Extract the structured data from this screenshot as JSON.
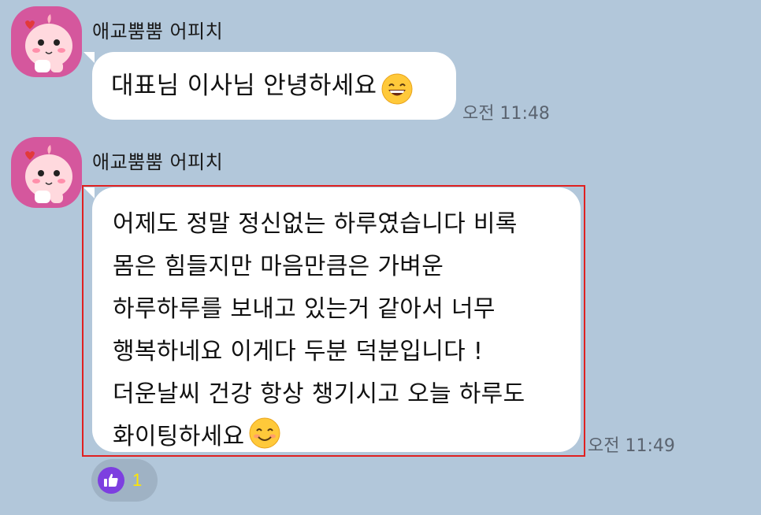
{
  "messages": [
    {
      "sender": "애교뿜뿜 어피치",
      "avatar_icon": "apeach-avatar-icon",
      "text": "대표님 이사님 안녕하세요",
      "emoji_icon": "grinning-face-emoji-icon",
      "time": "오전 11:48"
    },
    {
      "sender": "애교뿜뿜 어피치",
      "avatar_icon": "apeach-avatar-icon",
      "text": "어제도 정말 정신없는 하루였습니다 비록\n몸은 힘들지만 마음만큼은 가벼운\n하루하루를 보내고 있는거 같아서 너무\n행복하네요 이게다 두분 덕분입니다 !\n더운날씨 건강 항상 챙기시고 오늘 하루도\n화이팅하세요",
      "emoji_icon": "smiling-face-emoji-icon",
      "time": "오전 11:49",
      "highlighted": true,
      "reaction": {
        "icon": "thumbs-up-icon",
        "count": "1"
      }
    }
  ],
  "colors": {
    "background": "#b2c7da",
    "bubble": "#ffffff",
    "avatar_bg": "#d5579d",
    "highlight_border": "#e02020",
    "reaction_icon_bg": "#7d3fe0",
    "reaction_count": "#ffe600"
  }
}
